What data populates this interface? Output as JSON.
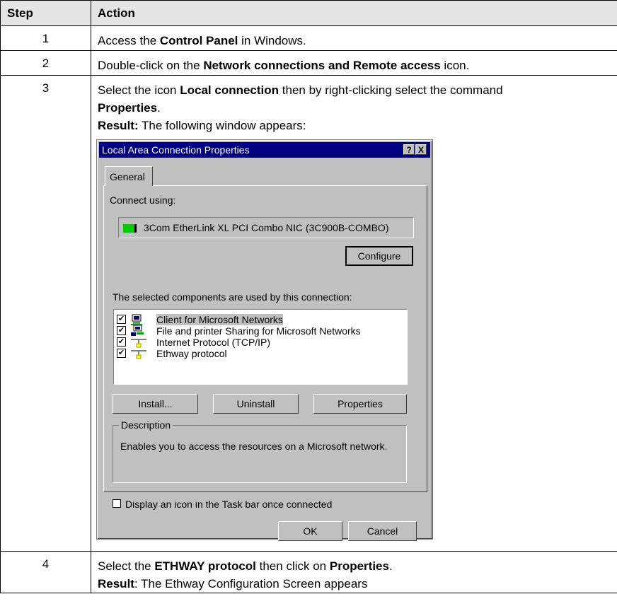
{
  "table": {
    "headers": [
      "Step",
      "Action"
    ],
    "rows": [
      {
        "step": "1",
        "text_parts": [
          "Access the ",
          "Control Panel",
          " in Windows."
        ]
      },
      {
        "step": "2",
        "text_parts": [
          "Double-click on the ",
          "Network connections and Remote access",
          " icon."
        ]
      },
      {
        "step": "3",
        "line1": [
          "Select the icon ",
          "Local connection",
          " then by right-clicking select the command"
        ],
        "line2": [
          "Properties",
          "."
        ],
        "line3": [
          "Result:",
          " The following window appears:"
        ]
      },
      {
        "step": "4",
        "line1": [
          "Select the ",
          "ETHWAY protocol",
          " then click on ",
          "Properties",
          "."
        ],
        "line2": [
          "Result",
          ": The Ethway Configuration Screen appears"
        ]
      }
    ]
  },
  "dialog": {
    "title": "Local Area Connection Properties",
    "help_btn": "?",
    "close_btn": "X",
    "tab": "General",
    "connect_using_label": "Connect using:",
    "adapter": "3Com EtherLink XL PCI Combo NIC (3C900B-COMBO)",
    "configure_btn": "Configure",
    "components_label": "The selected components are used by this connection:",
    "components": [
      {
        "label": "Client for Microsoft Networks",
        "checked": true,
        "icon": "network-client-icon"
      },
      {
        "label": "File and printer Sharing for Microsoft Networks",
        "checked": true,
        "icon": "file-sharing-icon"
      },
      {
        "label": "Internet Protocol (TCP/IP)",
        "checked": true,
        "icon": "protocol-icon"
      },
      {
        "label": "Ethway protocol",
        "checked": true,
        "icon": "protocol-icon"
      }
    ],
    "install_btn": "Install...",
    "uninstall_btn": "Uninstall",
    "properties_btn": "Properties",
    "description_legend": "Description",
    "description_text": "Enables you to access the resources on a Microsoft network.",
    "taskbar_checkbox": "Display an icon in the Task bar once connected",
    "taskbar_checked": false,
    "ok_btn": "OK",
    "cancel_btn": "Cancel",
    "colors": {
      "titlebar": "#000080",
      "face": "#c0c0c0",
      "adapter_icon": "#00cc00"
    }
  }
}
